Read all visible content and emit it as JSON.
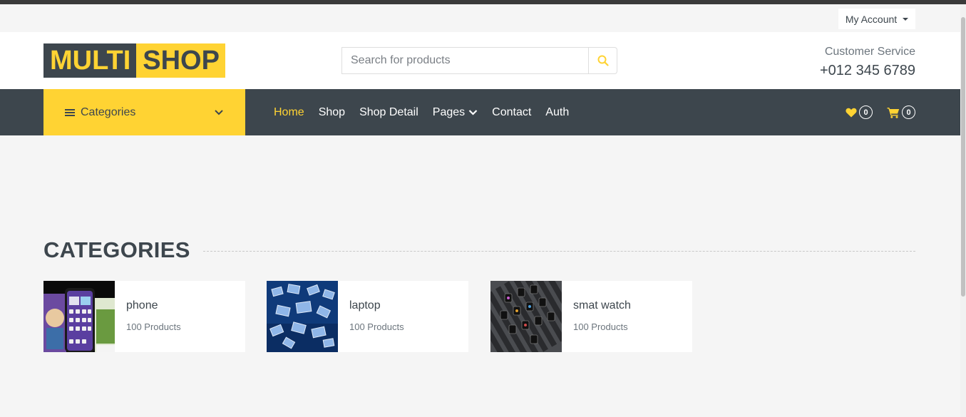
{
  "topbar": {
    "account_label": "My Account"
  },
  "header": {
    "logo_part1": "MULTI",
    "logo_part2": "SHOP",
    "search_placeholder": "Search for products",
    "service_label": "Customer Service",
    "service_phone": "+012 345 6789"
  },
  "navbar": {
    "categories_label": "Categories",
    "links": [
      {
        "label": "Home",
        "active": true
      },
      {
        "label": "Shop"
      },
      {
        "label": "Shop Detail"
      },
      {
        "label": "Pages",
        "dropdown": true
      },
      {
        "label": "Contact"
      },
      {
        "label": "Auth"
      }
    ],
    "wishlist_count": "0",
    "cart_count": "0"
  },
  "section": {
    "title": "CATEGORIES"
  },
  "categories": [
    {
      "name": "phone",
      "count": "100 Products",
      "icon": "phone-image"
    },
    {
      "name": "laptop",
      "count": "100 Products",
      "icon": "laptop-image"
    },
    {
      "name": "smat watch",
      "count": "100 Products",
      "icon": "smartwatch-image"
    }
  ],
  "colors": {
    "accent": "#ffd333",
    "dark": "#3d464d",
    "background": "#f5f5f5"
  }
}
